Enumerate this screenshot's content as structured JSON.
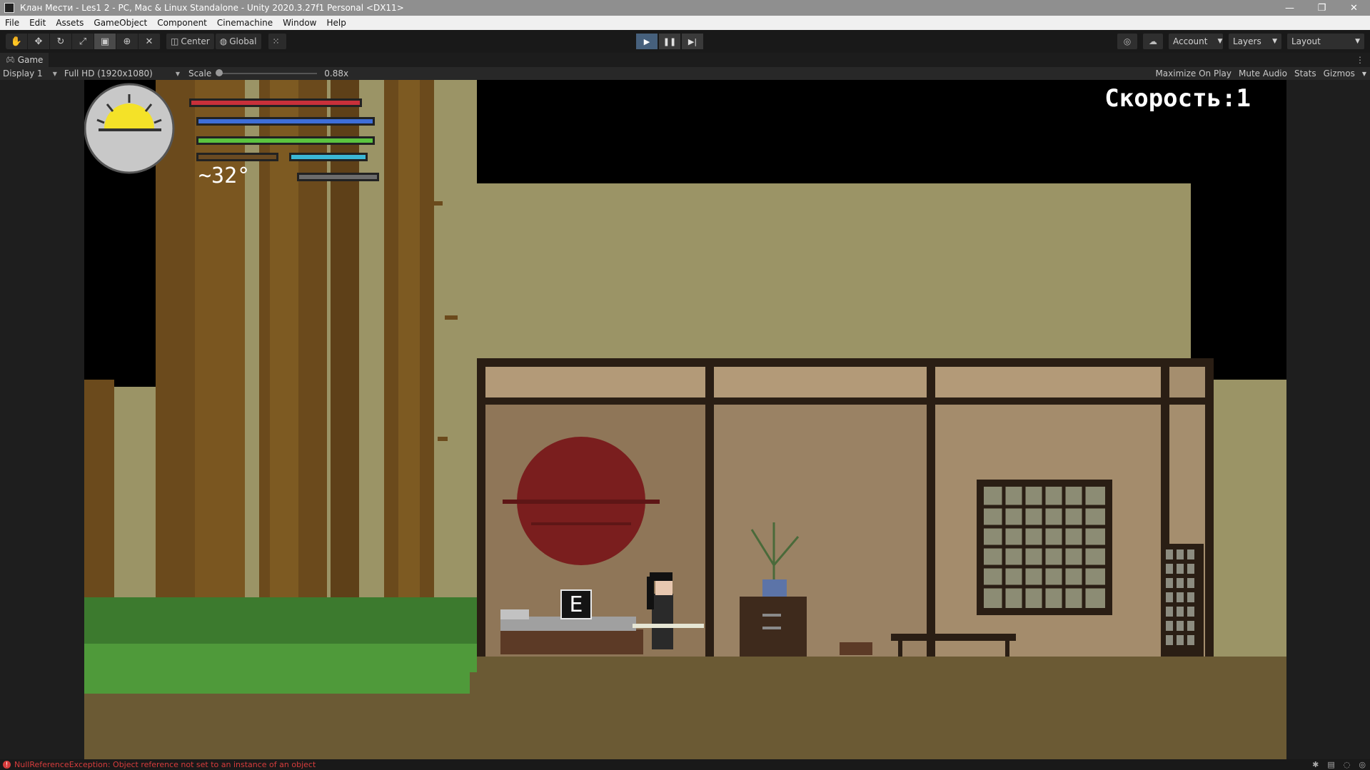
{
  "window": {
    "title": "Клан Мести - Les1 2 - PC, Mac & Linux Standalone - Unity 2020.3.27f1 Personal <DX11>",
    "controls": [
      "—",
      "❐",
      "✕"
    ]
  },
  "menu": [
    "File",
    "Edit",
    "Assets",
    "GameObject",
    "Component",
    "Cinemachine",
    "Window",
    "Help"
  ],
  "toolbar": {
    "tools": [
      "hand-tool-icon",
      "move-tool-icon",
      "rotate-tool-icon",
      "scale-tool-icon",
      "rect-tool-icon",
      "transform-tool-icon",
      "custom-tool-icon"
    ],
    "pivot_center": "Center",
    "pivot_global": "Global",
    "account": "Account",
    "layers": "Layers",
    "layout": "Layout"
  },
  "game_tab": {
    "label": "Game"
  },
  "game_bar": {
    "display": "Display 1",
    "resolution": "Full HD (1920x1080)",
    "scale_label": "Scale",
    "scale_value": "0.88x",
    "maximize": "Maximize On Play",
    "mute": "Mute Audio",
    "stats": "Stats",
    "gizmos": "Gizmos"
  },
  "hud": {
    "temperature": "~32°",
    "speed": "Скорость:1",
    "interact_key": "E",
    "bar_colors": {
      "health": "#c8303a",
      "mana": "#3e6ed8",
      "stamina": "#5bc43f",
      "hunger": "#6a4a22",
      "thirst": "#3bb7d6",
      "extra": "#6c6c6c"
    }
  },
  "status": {
    "error": "NullReferenceException: Object reference not set to an instance of an object"
  }
}
